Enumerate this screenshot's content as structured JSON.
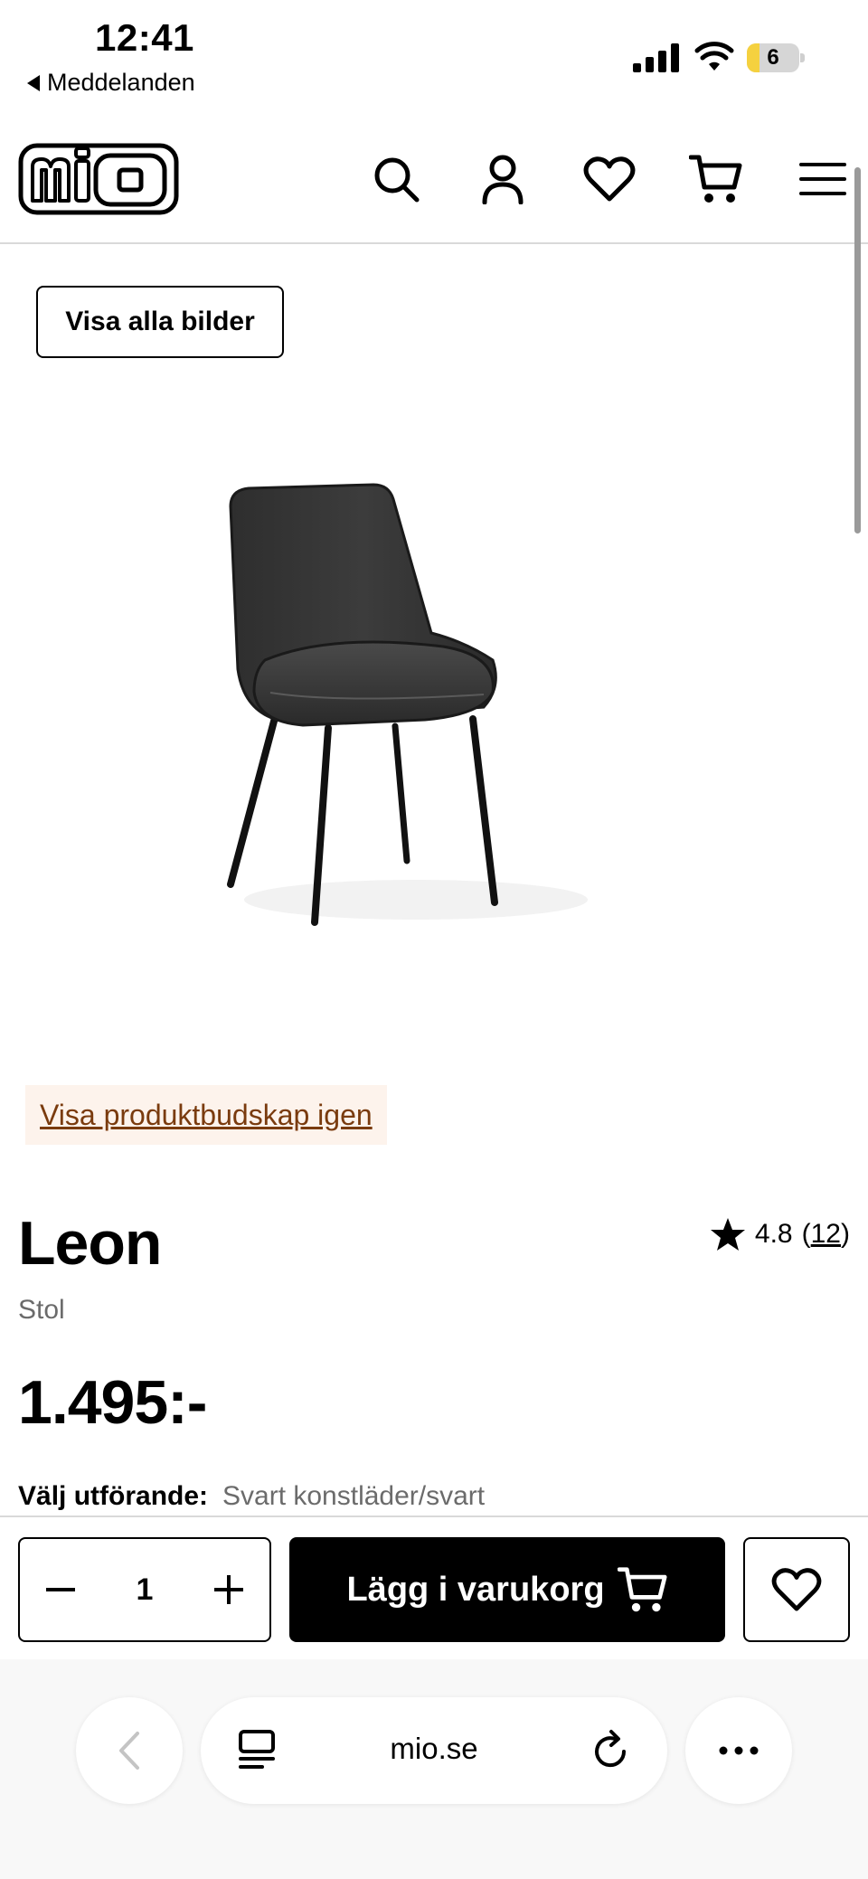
{
  "status_bar": {
    "time": "12:41",
    "back_app": "Meddelanden",
    "battery_level": "6"
  },
  "header": {
    "logo_text": "mio",
    "icons": [
      "search-icon",
      "account-icon",
      "heart-icon",
      "cart-icon",
      "menu-icon"
    ]
  },
  "gallery": {
    "view_all_label": "Visa alla bilder",
    "product_message_link": "Visa produktbudskap igen"
  },
  "product": {
    "name": "Leon",
    "category": "Stol",
    "rating": "4.8",
    "review_count": "12",
    "price": "1.495:-",
    "variant_label": "Välj utförande:",
    "variant_value": "Svart konstläder/svart"
  },
  "buy_bar": {
    "quantity": "1",
    "add_to_cart_label": "Lägg i varukorg"
  },
  "browser": {
    "url": "mio.se"
  },
  "colors": {
    "link_brown": "#7a3b0e",
    "link_bg": "#fdf3ec",
    "battery_yellow": "#f5d13f"
  }
}
